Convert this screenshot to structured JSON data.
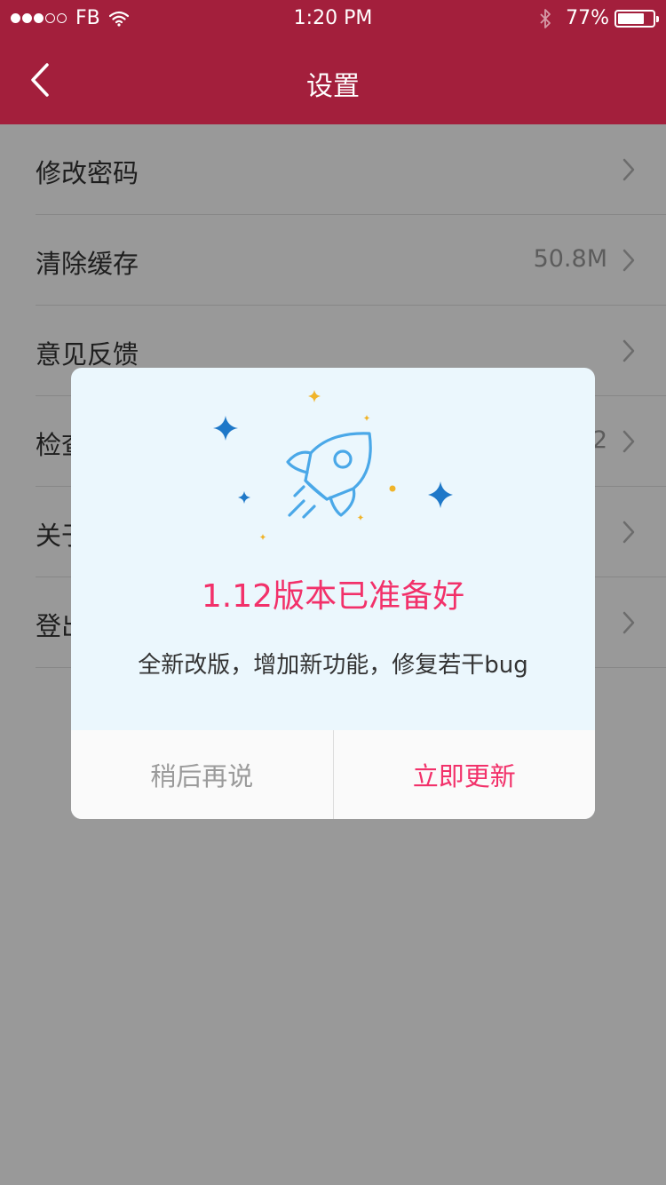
{
  "status_bar": {
    "carrier": "FB",
    "time": "1:20 PM",
    "battery_percent": "77%",
    "battery_level": 0.77,
    "signal_bars_filled": 3,
    "signal_bars_total": 5
  },
  "nav": {
    "title": "设置",
    "back_icon": "chevron-left-icon"
  },
  "settings": {
    "items": [
      {
        "label": "修改密码",
        "value": ""
      },
      {
        "label": "清除缓存",
        "value": "50.8M"
      },
      {
        "label": "意见反馈",
        "value": ""
      },
      {
        "label": "检查更新",
        "value": "1.12"
      },
      {
        "label": "关于我们",
        "value": ""
      },
      {
        "label": "登出",
        "value": ""
      }
    ]
  },
  "dialog": {
    "title": "1.12版本已准备好",
    "message": "全新改版，增加新功能，修复若干bug",
    "later_label": "稍后再说",
    "update_label": "立即更新",
    "illustration_icon": "rocket-icon"
  },
  "colors": {
    "brand": "#a31f3c",
    "accent": "#f2316a",
    "dialog_background": "#ebf7fd",
    "rocket_blue": "#4aa8e8",
    "star_blue": "#1e78c8",
    "star_gold": "#f0b42a"
  }
}
